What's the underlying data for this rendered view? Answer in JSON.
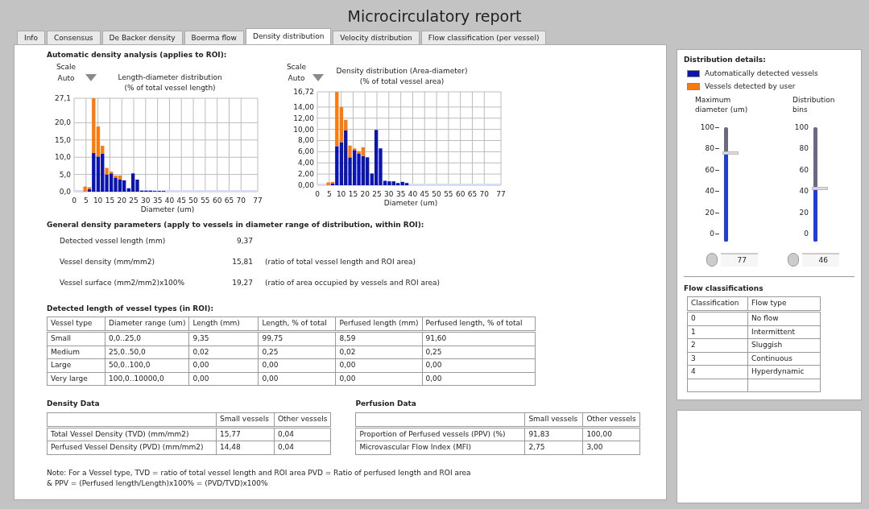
{
  "window": {
    "title": "Microcirculatory report"
  },
  "tabs": [
    {
      "label": "Info",
      "selected": false
    },
    {
      "label": "Consensus",
      "selected": false
    },
    {
      "label": "De Backer density",
      "selected": false
    },
    {
      "label": "Boerma flow",
      "selected": false
    },
    {
      "label": "Density distribution",
      "selected": true
    },
    {
      "label": "Velocity distribution",
      "selected": false
    },
    {
      "label": "Flow classification (per vessel)",
      "selected": false
    }
  ],
  "automatic_analysis": {
    "heading": "Automatic density analysis (applies to ROI):",
    "charts": [
      {
        "scale_label": "Scale",
        "scale_mode": "Auto",
        "chart_data": {
          "type": "bar",
          "stacked": true,
          "grid": true,
          "title": "Length-diameter distribution (% of total vessel length)",
          "xlabel": "Diameter (um)",
          "x": [
            4.6,
            6.4,
            8.2,
            10.1,
            11.9,
            13.7,
            15.6,
            17.4,
            19.2,
            21.0,
            22.9,
            24.7,
            26.5,
            28.4,
            30.2,
            32.0,
            33.8,
            35.7,
            37.5
          ],
          "series": [
            {
              "color": "#0a14b4",
              "values": [
                0,
                0.8,
                11.2,
                10.2,
                11.0,
                5.0,
                5.3,
                4.1,
                3.6,
                3.3,
                1.0,
                5.3,
                3.5,
                0.3,
                0.3,
                0.3,
                0.2,
                0.2,
                0.2
              ]
            },
            {
              "color": "#ff7a0a",
              "values": [
                1.5,
                0.5,
                15.9,
                8.7,
                2.3,
                1.9,
                0.5,
                0.6,
                1.1,
                0,
                0,
                0,
                0,
                0,
                0,
                0,
                0,
                0,
                0
              ]
            }
          ],
          "xlim": [
            0,
            77
          ],
          "ylim": [
            0,
            27.1
          ],
          "xticks": [
            0,
            5,
            10,
            15,
            20,
            25,
            30,
            35,
            40,
            45,
            50,
            55,
            60,
            65,
            70,
            77
          ],
          "yticks": [
            {
              "value": 0,
              "label": "0,0"
            },
            {
              "value": 5,
              "label": "5,0"
            },
            {
              "value": 10,
              "label": "10,0"
            },
            {
              "value": 15,
              "label": "15,0"
            },
            {
              "value": 20,
              "label": "20,0"
            },
            {
              "value": 27.1,
              "label": "27,1"
            }
          ]
        }
      },
      {
        "scale_label": "Scale",
        "scale_mode": "Auto",
        "chart_data": {
          "type": "bar",
          "stacked": true,
          "grid": true,
          "title": "Density distribution (Area-diameter) (% of total vessel area)",
          "xlabel": "Diameter (um)",
          "x": [
            4.6,
            6.4,
            8.2,
            10.1,
            11.9,
            13.7,
            15.6,
            17.4,
            19.2,
            21.0,
            22.9,
            24.7,
            26.5,
            28.4,
            30.2,
            32.0,
            33.8,
            35.7,
            37.5
          ],
          "series": [
            {
              "color": "#0a14b4",
              "values": [
                0,
                0.3,
                7.0,
                7.7,
                9.8,
                5.0,
                6.3,
                5.7,
                5.2,
                5.0,
                2.1,
                9.9,
                6.6,
                0.8,
                0.7,
                0.7,
                0.4,
                0.6,
                0.4
              ]
            },
            {
              "color": "#ff7a0a",
              "values": [
                0.5,
                0.3,
                9.7,
                6.3,
                1.9,
                2.1,
                0.3,
                0.4,
                1.6,
                0,
                0,
                0,
                0,
                0,
                0,
                0,
                0,
                0,
                0
              ]
            }
          ],
          "xlim": [
            0,
            77
          ],
          "ylim": [
            0,
            16.72
          ],
          "xticks": [
            0,
            5,
            10,
            15,
            20,
            25,
            30,
            35,
            40,
            45,
            50,
            55,
            60,
            65,
            70,
            77
          ],
          "yticks": [
            {
              "value": 0,
              "label": "0,00"
            },
            {
              "value": 2,
              "label": "2,00"
            },
            {
              "value": 4,
              "label": "4,00"
            },
            {
              "value": 6,
              "label": "6,00"
            },
            {
              "value": 8,
              "label": "8,00"
            },
            {
              "value": 10,
              "label": "10,00"
            },
            {
              "value": 12,
              "label": "12,00"
            },
            {
              "value": 14,
              "label": "14,00"
            },
            {
              "value": 16.72,
              "label": "16,72"
            }
          ]
        }
      }
    ]
  },
  "general_parameters": {
    "heading": "General density parameters (apply to vessels in diameter range of distribution, within ROI):",
    "rows": [
      {
        "label": "Detected vessel length (mm)",
        "value": "9,37"
      },
      {
        "label": "Vessel density (mm/mm2)",
        "value": "15,81",
        "note": "(ratio of total vessel length and ROI area)"
      },
      {
        "label": "Vessel surface (mm2/mm2)x100%",
        "value": "19,27",
        "note": "(ratio of area occupied by vessels and ROI area)"
      }
    ]
  },
  "vessel_types": {
    "heading": "Detected length of vessel types (in ROI):",
    "columns": [
      "Vessel type",
      "Diameter range (um)",
      "Length (mm)",
      "Length, % of total",
      "Perfused length (mm)",
      "Perfused length, % of total"
    ],
    "rows": [
      [
        "Small",
        "0,0..25,0",
        "9,35",
        "99,75",
        "8,59",
        "91,60"
      ],
      [
        "Medium",
        "25,0..50,0",
        "0,02",
        "0,25",
        "0,02",
        "0,25"
      ],
      [
        "Large",
        "50,0..100,0",
        "0,00",
        "0,00",
        "0,00",
        "0,00"
      ],
      [
        "Very large",
        "100,0..10000,0",
        "0,00",
        "0,00",
        "0,00",
        "0,00"
      ]
    ]
  },
  "density_data": {
    "heading": "Density Data",
    "columns": [
      "",
      "Small vessels",
      "Other vessels"
    ],
    "rows": [
      [
        "Total Vessel Density (TVD) (mm/mm2)",
        "15,77",
        "0,04"
      ],
      [
        "Perfused Vessel Density (PVD) (mm/mm2)",
        "14,48",
        "0,04"
      ]
    ]
  },
  "perfusion_data": {
    "heading": "Perfusion Data",
    "columns": [
      "",
      "Small vessels",
      "Other vessels"
    ],
    "rows": [
      [
        "Proportion of Perfused vessels (PPV) (%)",
        "91,83",
        "100,00"
      ],
      [
        "Microvascular Flow Index (MFI)",
        "2,75",
        "3,00"
      ]
    ]
  },
  "note": [
    "Note: For a Vessel type, TVD = ratio of total vessel length and ROI area PVD = Ratio of perfused length and ROI area",
    "& PPV = (Perfused length/Length)x100% = (PVD/TVD)x100%"
  ],
  "distribution_details": {
    "heading": "Distribution details:",
    "legend": [
      {
        "label": "Automatically detected vessels",
        "color": "#0a14b4"
      },
      {
        "label": "Vessels detected by user",
        "color": "#ff7a0a"
      }
    ],
    "sliders": [
      {
        "label": "Maximum diameter (um)",
        "ticks": [
          "100",
          "80",
          "60",
          "40",
          "20",
          "0"
        ],
        "level": 0.77,
        "value": "77"
      },
      {
        "label": "Distribution bins",
        "ticks": [
          "100",
          "80",
          "60",
          "40",
          "20",
          "0"
        ],
        "level": 0.46,
        "value": "46"
      }
    ]
  },
  "flow_classifications": {
    "heading": "Flow classifications",
    "columns": [
      "Classification",
      "Flow type"
    ],
    "rows": [
      [
        "0",
        "No flow"
      ],
      [
        "1",
        "Intermittent"
      ],
      [
        "2",
        "Sluggish"
      ],
      [
        "3",
        "Continuous"
      ],
      [
        "4",
        "Hyperdynamic"
      ]
    ]
  }
}
